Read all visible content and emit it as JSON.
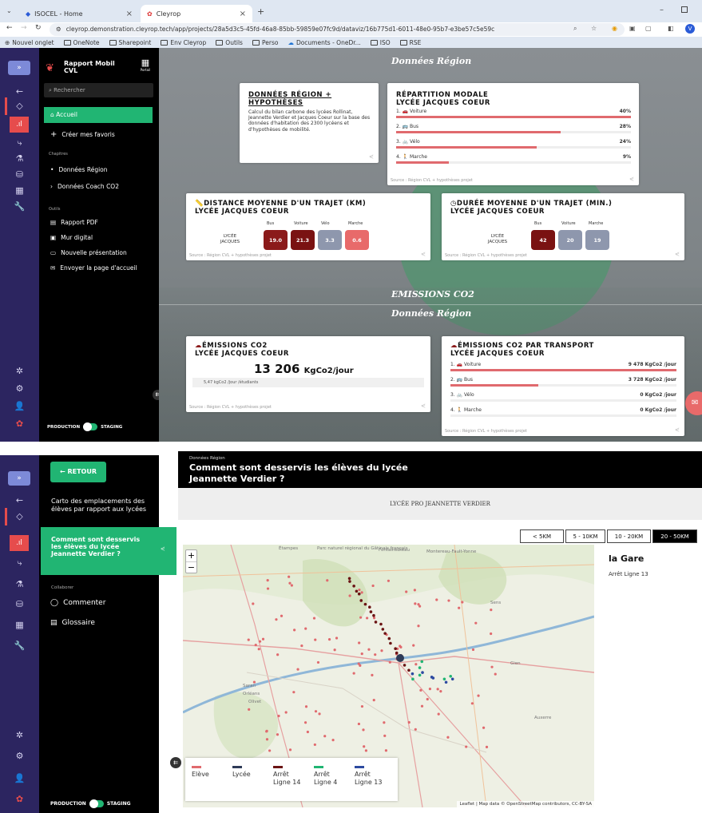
{
  "browser": {
    "tabs": [
      {
        "label": "ISOCEL - Home"
      },
      {
        "label": "Cleyrop"
      }
    ],
    "url": "cleyrop.demonstration.cleyrop.tech/app/projects/28a5d3c5-45fd-46a8-85bb-59859e07fc9d/dataviz/16b775d1-6011-48e0-95b7-e3be57c5e59c",
    "bookmarks": [
      "Nouvel onglet",
      "OneNote",
      "Sharepoint",
      "Env Cleyrop",
      "Outils",
      "Perso",
      "Documents - OneDr...",
      "ISO",
      "RSE"
    ],
    "profile_initial": "V"
  },
  "top": {
    "panel": {
      "brand_line1": "Rapport Mobil",
      "brand_line2": "CVL",
      "portail_label": "Portail",
      "search_placeholder": "Rechercher",
      "accueil": "Accueil",
      "favoris": "Créer mes favoris",
      "chapitres_heading": "Chapitres",
      "chapitres": [
        "Données Région",
        "Données Coach CO2"
      ],
      "outils_heading": "Outils",
      "outils": [
        "Rapport PDF",
        "Mur digital",
        "Nouvelle présentation",
        "Envoyer la page d'accueil"
      ],
      "env_production": "PRODUCTION",
      "env_staging": "STAGING"
    },
    "section_title_top": "Données Région",
    "card_intro": {
      "title_line1": "DONNÉES RÉGION +",
      "title_line2": "HYPOTHÈSES",
      "text": "Calcul du bilan carbone des lycées Rollinat, Jeannette Verdier et Jacques Coeur sur la base des données d'habitation des 2300 lycéens et d'hypothèses de mobilité."
    },
    "card_modal": {
      "title_line1": "RÉPARTITION MODALE",
      "title_line2": "LYCÉE JACQUES COEUR",
      "rows": [
        {
          "label": "1. 🚗 Voiture",
          "pct": "40%",
          "frac": 1.0
        },
        {
          "label": "2. 🚌 Bus",
          "pct": "28%",
          "frac": 0.7
        },
        {
          "label": "3. 🚲 Vélo",
          "pct": "24%",
          "frac": 0.6
        },
        {
          "label": "4. 🚶 Marche",
          "pct": "9%",
          "frac": 0.225
        }
      ],
      "source": "Source : Région CVL + hypothèses projet"
    },
    "card_distance": {
      "title_line1": "DISTANCE MOYENNE D'UN TRAJET (KM)",
      "title_line2": "LYCÉE JACQUES COEUR",
      "row_label_1": "LYCÉE",
      "row_label_2": "JACQUES",
      "modes": [
        "Bus",
        "Voiture",
        "Vélo",
        "Marche"
      ],
      "values": [
        "19.0",
        "21.3",
        "3.3",
        "0.6"
      ],
      "colors": [
        "#8b1a1a",
        "#7a1212",
        "#8e97ad",
        "#e86a6a"
      ],
      "source": "Source : Région CVL + hypothèses projet"
    },
    "card_duree": {
      "title_line1": "DURÉE MOYENNE D'UN TRAJET (MIN.)",
      "title_line2": "LYCÉE JACQUES COEUR",
      "row_label_1": "LYCÉE",
      "row_label_2": "JACQUES",
      "modes": [
        "Bus",
        "Voiture",
        "Marche"
      ],
      "values": [
        "42",
        "20",
        "19"
      ],
      "colors": [
        "#7a1212",
        "#8e97ad",
        "#8e97ad"
      ],
      "source": "Source : Région CVL + hypothèses projet"
    },
    "section_title_emissions": "EMISSIONS CO2",
    "section_title_region": "Données Région",
    "card_emissions": {
      "title_line1": "ÉMISSIONS CO2",
      "title_line2": "LYCÉE JACQUES COEUR",
      "value": "13 206",
      "unit": "KgCo2/jour",
      "sub": "5,47 kgCo2 /jour /étudiants",
      "source": "Source : Région CVL + hypothèses projet"
    },
    "card_emissions_transport": {
      "title_line1": "ÉMISSIONS CO2 PAR TRANSPORT",
      "title_line2": "LYCÉE JACQUES COEUR",
      "rows": [
        {
          "label": "1. 🚗 Voiture",
          "val": "9 478 KgCo2 /jour",
          "frac": 1.0
        },
        {
          "label": "2. 🚌 Bus",
          "val": "3 728 KgCo2 /jour",
          "frac": 0.39
        },
        {
          "label": "3. 🚲 Vélo",
          "val": "0 KgCo2 /jour",
          "frac": 0
        },
        {
          "label": "4. 🚶 Marche",
          "val": "0 KgCo2 /jour",
          "frac": 0
        }
      ],
      "source": "Source : Région CVL + hypothèses projet"
    }
  },
  "bottom": {
    "back_label": "← RETOUR",
    "header_small": "Données Région",
    "header_title_1": "Comment sont desservis les élèves du lycée",
    "header_title_2": "Jeannette Verdier ?",
    "nav": [
      {
        "label": "Carto des emplacements des élèves par rapport aux lycées",
        "active": false
      },
      {
        "label": "Comment sont desservis les élèves du lycée Jeannette Verdier ?",
        "active": true
      }
    ],
    "collaborer_heading": "Collaborer",
    "commenter": "Commenter",
    "glossaire": "Glossaire",
    "env_production": "PRODUCTION",
    "env_staging": "STAGING",
    "lycee_banner": "LYCÉE PRO JEANNETTE VERDIER",
    "distance_tabs": [
      {
        "label": "< 5KM",
        "active": false
      },
      {
        "label": "5 - 10KM",
        "active": false
      },
      {
        "label": "10 - 20KM",
        "active": false
      },
      {
        "label": "20 - 50KM",
        "active": true
      }
    ],
    "side_title": "la Gare",
    "side_sub": "Arrêt Ligne 13",
    "legend": [
      {
        "label": "Elève",
        "color": "#e06a6e"
      },
      {
        "label": "Lycée",
        "color": "#2e3b57"
      },
      {
        "label": "Arrêt\nLigne 14",
        "color": "#6b1414"
      },
      {
        "label": "Arrêt\nLigne 4",
        "color": "#21b573"
      },
      {
        "label": "Arrêt\nLigne 13",
        "color": "#2d4aa0"
      }
    ],
    "map_places": [
      "Étampes",
      "Parc naturel régional du Gâtinais français",
      "Fontainebleau",
      "Montereau-Fault-Yonne",
      "Sens",
      "Saran",
      "Orléans",
      "Olivet",
      "Gien",
      "Auxerre"
    ],
    "attribution": "Leaflet | Map data © OpenStreetMap contributors, CC-BY-SA",
    "zoom_in": "+",
    "zoom_out": "−"
  }
}
